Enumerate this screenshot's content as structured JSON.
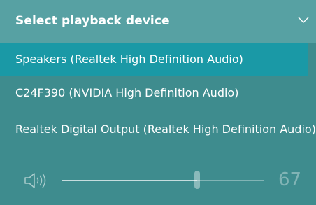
{
  "header": {
    "title": "Select playback device",
    "chevron_icon": "chevron-down-icon"
  },
  "devices": [
    {
      "label": "Speakers (Realtek High Definition Audio)",
      "selected": true
    },
    {
      "label": "C24F390 (NVIDIA High Definition Audio)",
      "selected": false
    },
    {
      "label": "Realtek Digital Output (Realtek High Definition Audio)",
      "selected": false
    }
  ],
  "volume": {
    "icon": "speaker-volume-icon",
    "level": 67,
    "display": "67"
  },
  "colors": {
    "panel_background": "#3e8c8e",
    "header_background": "#57a1a3",
    "selected_background": "#1a99a6",
    "text": "#ffffff"
  }
}
